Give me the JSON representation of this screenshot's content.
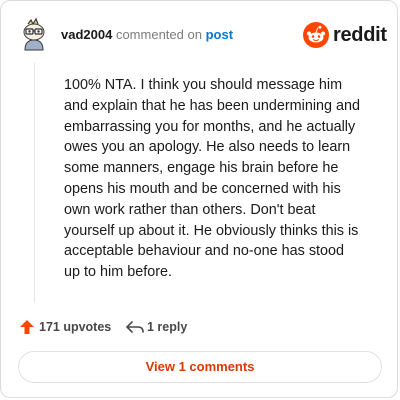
{
  "header": {
    "username": "vad2004",
    "action_text": "commented on",
    "post_link": "post",
    "brand_name": "reddit",
    "brand_color": "#ff4500"
  },
  "comment": {
    "body": "100% NTA. I think you should message him and explain that he has been undermining and embarrassing you for months, and he actually owes you an apology. He also needs to learn some manners, engage his brain before he opens his mouth and be concerned with his own work rather than others. Don't beat yourself up about it. He obviously thinks this is acceptable behaviour and no-one has stood up to him before."
  },
  "actions": {
    "upvote_label": "171 upvotes",
    "upvote_icon": "upvote-arrow-icon",
    "upvote_color": "#ff4500",
    "reply_label": "1 reply",
    "reply_icon": "reply-arrow-icon"
  },
  "footer": {
    "view_comments_label": "View 1 comments",
    "button_text_color": "#d93a00"
  }
}
